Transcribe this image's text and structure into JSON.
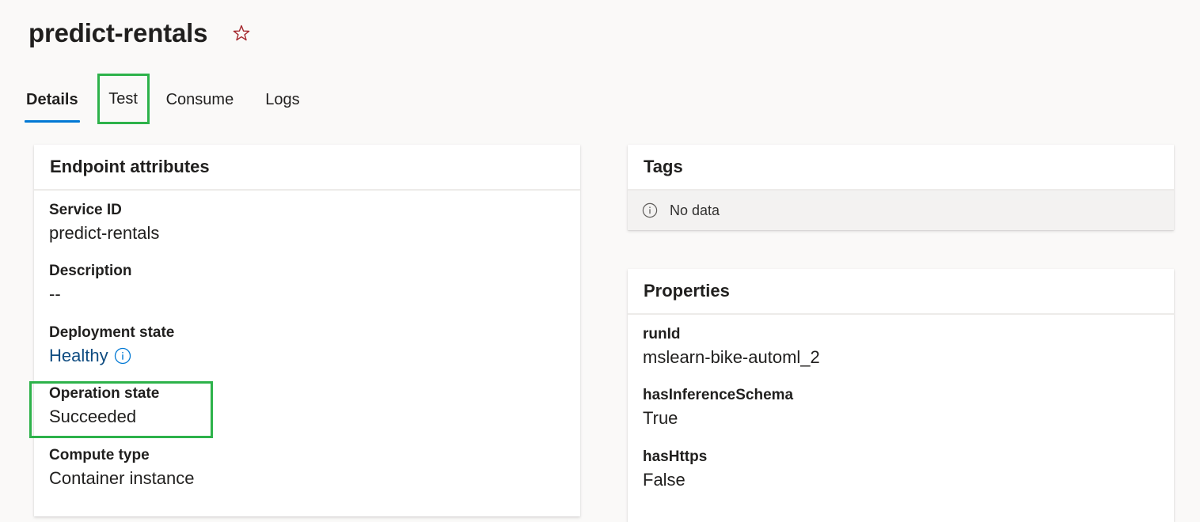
{
  "page": {
    "title": "predict-rentals",
    "favorite_icon": "star-outline-icon"
  },
  "tabs": [
    {
      "label": "Details",
      "selected": true
    },
    {
      "label": "Test",
      "selected": false
    },
    {
      "label": "Consume",
      "selected": false
    },
    {
      "label": "Logs",
      "selected": false
    }
  ],
  "endpoint_attributes": {
    "header": "Endpoint attributes",
    "fields": [
      {
        "label": "Service ID",
        "value": "predict-rentals"
      },
      {
        "label": "Description",
        "value": "--"
      },
      {
        "label": "Deployment state",
        "value": "Healthy"
      },
      {
        "label": "Operation state",
        "value": "Succeeded"
      },
      {
        "label": "Compute type",
        "value": "Container instance"
      }
    ]
  },
  "tags": {
    "header": "Tags",
    "empty_text": "No data"
  },
  "properties": {
    "header": "Properties",
    "fields": [
      {
        "label": "runId",
        "value": "mslearn-bike-automl_2"
      },
      {
        "label": "hasInferenceSchema",
        "value": "True"
      },
      {
        "label": "hasHttps",
        "value": "False"
      }
    ]
  },
  "colors": {
    "accent": "#0078d4",
    "highlight": "#2db24a",
    "star": "#a4262c",
    "healthy_link": "#0f4c81"
  }
}
